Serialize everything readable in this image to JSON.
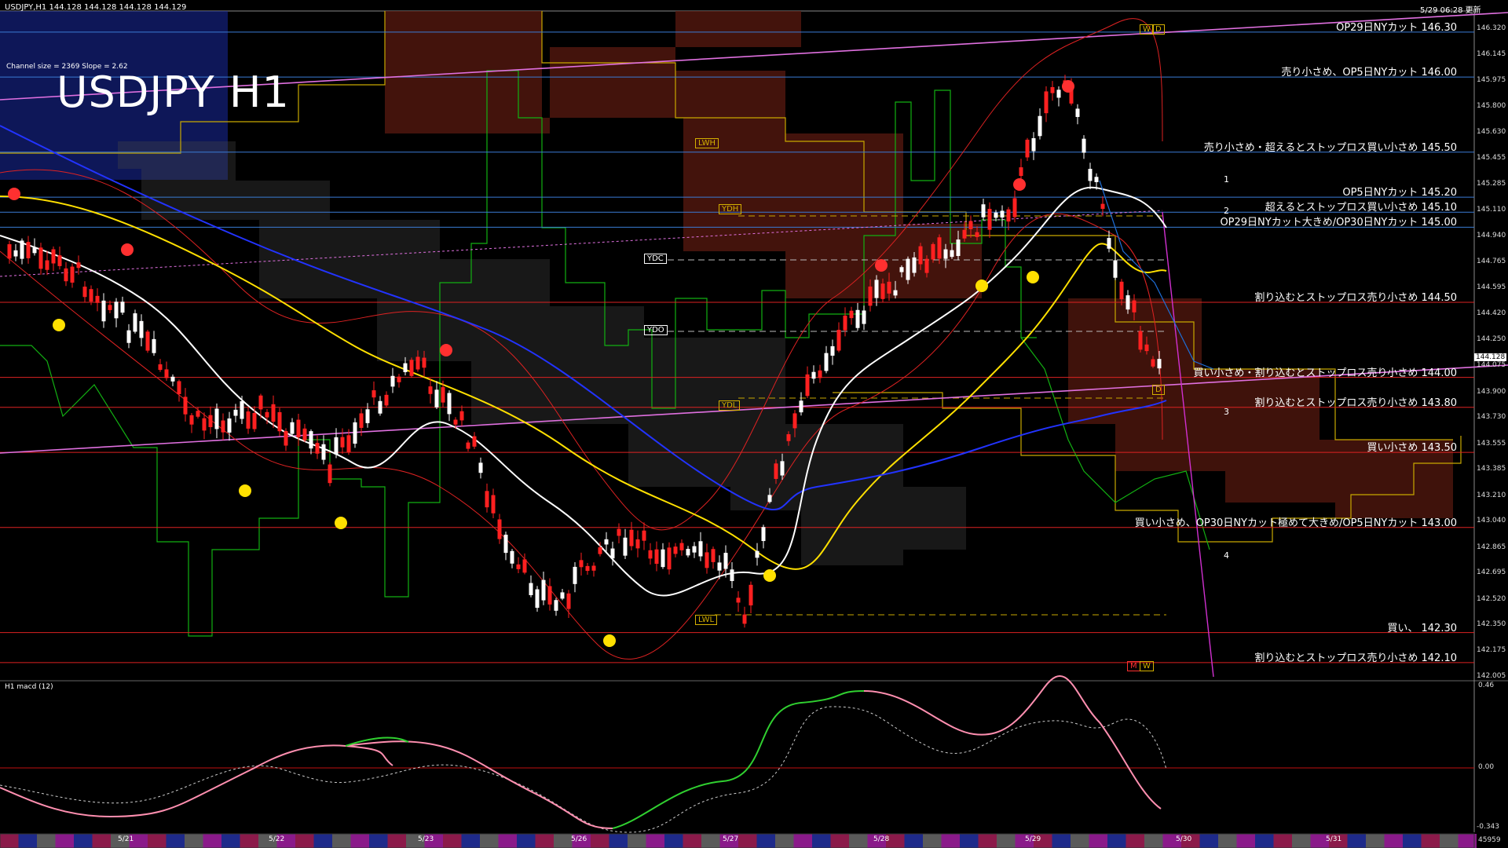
{
  "header": {
    "symbol_info": "USDJPY,H1  144.128 144.128 144.128 144.129",
    "timestamp": "5/29 06:28 更新",
    "channel_info": "Channel size = 2369 Slope = 2.62",
    "big_title": "USDJPY H1"
  },
  "levels": [
    {
      "label": "OP29日NYカット 146.30",
      "price": 146.3,
      "color": "#3a7bd5"
    },
    {
      "label": "売り小さめ、OP5日NYカット 146.00",
      "price": 146.0,
      "color": "#3a7bd5"
    },
    {
      "label": "売り小さめ・超えるとストップロス買い小さめ 145.50",
      "price": 145.5,
      "color": "#3a7bd5"
    },
    {
      "label": "OP5日NYカット 145.20",
      "price": 145.2,
      "color": "#3a7bd5"
    },
    {
      "label": "超えるとストップロス買い小さめ 145.10",
      "price": 145.1,
      "color": "#3a7bd5"
    },
    {
      "label": "OP29日NYカット大きめ/OP30日NYカット 145.00",
      "price": 145.0,
      "color": "#3a7bd5"
    },
    {
      "label": "割り込むとストップロス売り小さめ 144.50",
      "price": 144.5,
      "color": "#d22"
    },
    {
      "label": "買い小さめ・割り込むとストップロス売り小さめ 144.00",
      "price": 144.0,
      "color": "#d22"
    },
    {
      "label": "割り込むとストップロス売り小さめ 143.80",
      "price": 143.8,
      "color": "#d22"
    },
    {
      "label": "買い小さめ 143.50",
      "price": 143.5,
      "color": "#d22"
    },
    {
      "label": "買い小さめ、OP30日NYカット極めて大きめ/OP5日NYカット 143.00",
      "price": 143.0,
      "color": "#d22"
    },
    {
      "label": "買い、  142.30",
      "price": 142.3,
      "color": "#d22"
    },
    {
      "label": "割り込むとストップロス売り小さめ 142.10",
      "price": 142.1,
      "color": "#d22"
    }
  ],
  "y_axis": [
    "146.320",
    "146.145",
    "145.975",
    "145.800",
    "145.630",
    "145.455",
    "145.285",
    "145.110",
    "144.940",
    "144.765",
    "144.595",
    "144.420",
    "144.250",
    "144.075",
    "143.900",
    "143.730",
    "143.555",
    "143.385",
    "143.210",
    "143.040",
    "142.865",
    "142.695",
    "142.520",
    "142.350",
    "142.175",
    "142.005"
  ],
  "current_price": "144.128",
  "markers": {
    "ydh": "YDH",
    "ydc": "YDC",
    "ydo": "YDO",
    "ydl": "YDL",
    "lwh": "LWH",
    "lwl": "LWL",
    "wd": "D",
    "m": "M",
    "w": "W"
  },
  "wave_labels": [
    "1",
    "2",
    "3",
    "4"
  ],
  "macd": {
    "title": "H1  macd (12)",
    "axis_top": "0.46",
    "axis_zero": "0.00",
    "axis_bottom": "-0.343"
  },
  "dates": [
    "5/21",
    "5/22",
    "5/23",
    "5/26",
    "5/27",
    "5/28",
    "5/29",
    "5/30",
    "5/31"
  ],
  "bottom_right": "45959",
  "colors": {
    "bg": "#000000",
    "bull": "#ffffff",
    "bear": "#ff2020",
    "ma_short": "#ffffff",
    "ma_mid": "#ffe000",
    "ma_long": "#2233ff"
  }
}
